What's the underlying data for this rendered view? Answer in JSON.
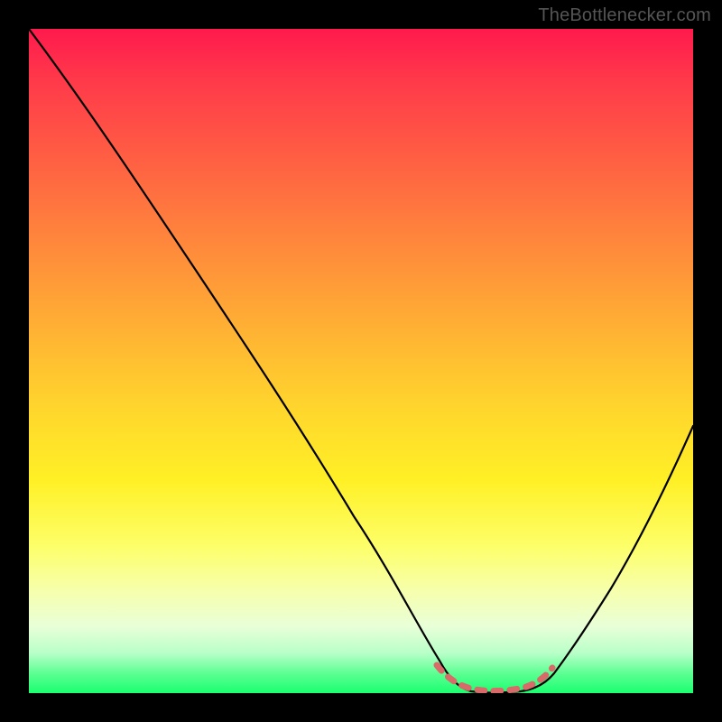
{
  "watermark": "TheBottleneсker.com",
  "chart_data": {
    "type": "line",
    "title": "",
    "xlabel": "",
    "ylabel": "",
    "xlim": [
      0,
      100
    ],
    "ylim": [
      0,
      100
    ],
    "grid": false,
    "legend": false,
    "background_gradient": {
      "stops": [
        {
          "pos": 0.0,
          "color": "#ff1a4d"
        },
        {
          "pos": 0.5,
          "color": "#ffba32"
        },
        {
          "pos": 0.78,
          "color": "#fdff6a"
        },
        {
          "pos": 1.0,
          "color": "#1aff70"
        }
      ],
      "direction": "top-to-bottom"
    },
    "series": [
      {
        "name": "bottleneck-curve",
        "color": "#000000",
        "x": [
          0,
          5,
          10,
          15,
          20,
          25,
          30,
          35,
          40,
          45,
          50,
          55,
          60,
          62,
          65,
          68,
          72,
          75,
          78,
          80,
          85,
          90,
          95,
          100
        ],
        "values": [
          100,
          93,
          86,
          78,
          71,
          63,
          55,
          47,
          40,
          32,
          24,
          16,
          8,
          4,
          1,
          0,
          0,
          0,
          1,
          3,
          10,
          20,
          32,
          46
        ]
      }
    ],
    "annotations": [
      {
        "name": "valley-floor-marker",
        "type": "dashed-segment",
        "color": "#d86a6a",
        "x_start": 62,
        "x_end": 78,
        "y": 2
      }
    ]
  }
}
